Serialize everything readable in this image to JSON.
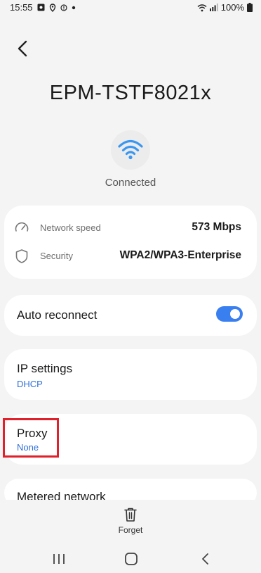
{
  "status_bar": {
    "time": "15:55",
    "battery_percent": "100%"
  },
  "network": {
    "ssid": "EPM-TSTF8021x",
    "status": "Connected"
  },
  "details": {
    "speed_label": "Network speed",
    "speed_value": "573 Mbps",
    "security_label": "Security",
    "security_value": "WPA2/WPA3-Enterprise"
  },
  "auto_reconnect": {
    "label": "Auto reconnect",
    "enabled": true
  },
  "ip_settings": {
    "label": "IP settings",
    "value": "DHCP"
  },
  "proxy": {
    "label": "Proxy",
    "value": "None"
  },
  "metered": {
    "label": "Metered network"
  },
  "actions": {
    "forget_label": "Forget"
  },
  "colors": {
    "accent": "#3a7ff0",
    "link": "#2f6fd6",
    "highlight": "#e0202a"
  }
}
